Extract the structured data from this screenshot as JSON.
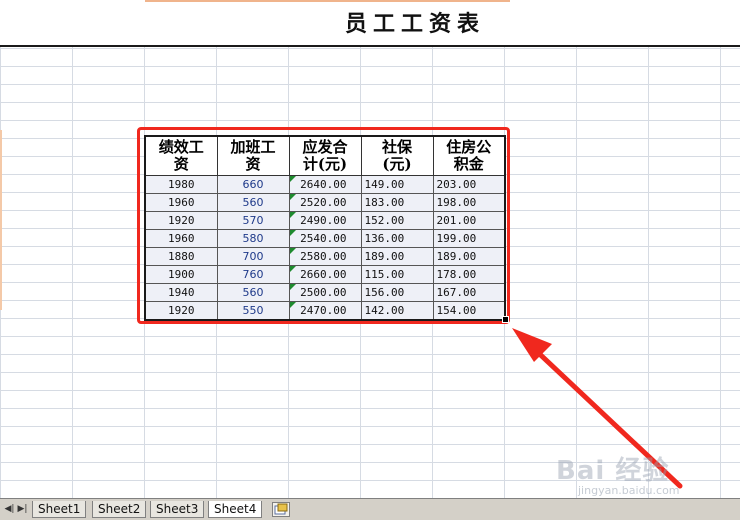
{
  "title": "员工工资表",
  "table": {
    "headers": [
      [
        "绩效工",
        "资"
      ],
      [
        "加班工",
        "资"
      ],
      [
        "应发合",
        "计(元)"
      ],
      [
        "社保",
        "(元)"
      ],
      [
        "住房公",
        "积金"
      ]
    ],
    "rows": [
      [
        "1980",
        "660",
        "2640.00",
        "149.00",
        "203.00"
      ],
      [
        "1960",
        "560",
        "2520.00",
        "183.00",
        "198.00"
      ],
      [
        "1920",
        "570",
        "2490.00",
        "152.00",
        "201.00"
      ],
      [
        "1960",
        "580",
        "2540.00",
        "136.00",
        "199.00"
      ],
      [
        "1880",
        "700",
        "2580.00",
        "189.00",
        "189.00"
      ],
      [
        "1900",
        "760",
        "2660.00",
        "115.00",
        "178.00"
      ],
      [
        "1940",
        "560",
        "2500.00",
        "156.00",
        "167.00"
      ],
      [
        "1920",
        "550",
        "2470.00",
        "142.00",
        "154.00"
      ]
    ]
  },
  "colors": {
    "highlight": "#f0281e",
    "arrow": "#f0281e",
    "number_blue": "#1f3a8a",
    "error_marker": "#1e8a2e"
  },
  "watermark": {
    "text": "Bai 经验",
    "sub": "jingyan.baidu.com"
  },
  "sheet_tabs": [
    "Sheet1",
    "Sheet2",
    "Sheet3",
    "Sheet4"
  ],
  "active_tab": "Sheet4",
  "icons": {
    "nav_first": "first-sheet-icon",
    "nav_prev": "prev-sheet-icon",
    "insert_sheet": "insert-sheet-icon"
  }
}
